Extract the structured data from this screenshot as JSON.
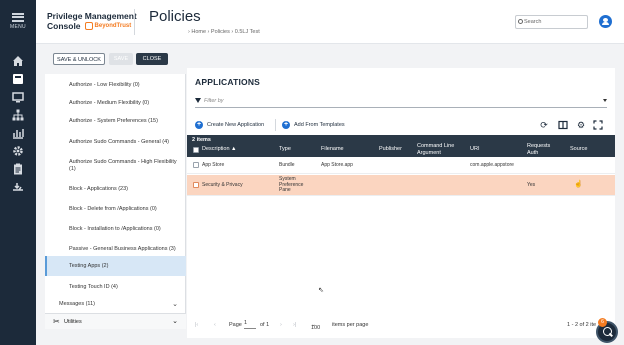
{
  "nav": {
    "menu_label": "MENU",
    "icons": [
      "home-icon",
      "policy-icon",
      "monitor-icon",
      "hierarchy-icon",
      "analytics-icon",
      "settings-icon",
      "clipboard-icon",
      "deploy-icon"
    ]
  },
  "header": {
    "brand_line1": "Privilege Management",
    "brand_line2": "Console",
    "brand_company": "BeyondTrust",
    "title": "Policies",
    "breadcrumb": "›  Home  ›  Policies  ›  0.5LJ Test",
    "search_placeholder": "Search"
  },
  "toolbar": {
    "save_unlock": "SAVE & UNLOCK",
    "save": "SAVE",
    "close": "CLOSE"
  },
  "sidebar": {
    "items": [
      {
        "label": "Authorize - Low Flexibility (0)"
      },
      {
        "label": "Authorize - Medium Flexibility (0)"
      },
      {
        "label": "Authorize - System Preferences (15)"
      },
      {
        "label": "Authorize Sudo Commands - General (4)"
      },
      {
        "label": "Authorize Sudo Commands - High Flexibility (1)"
      },
      {
        "label": "Block - Applications (23)"
      },
      {
        "label": "Block - Delete from /Applications (0)"
      },
      {
        "label": "Block - Installation to /Applications (0)"
      },
      {
        "label": "Passive - General Business Applications (3)"
      },
      {
        "label": "Testing Apps (2)"
      },
      {
        "label": "Testing Touch ID (4)"
      }
    ],
    "messages": "Messages (11)",
    "utilities": "Utilities"
  },
  "apps": {
    "title": "APPLICATIONS",
    "filter_placeholder": "Filter by",
    "create_label": "Create New Application",
    "templates_label": "Add From Templates",
    "count": "2 items",
    "columns": {
      "description": "Description ▲",
      "type": "Type",
      "filename": "Filename",
      "publisher": "Publisher",
      "cmd1": "Command Line",
      "cmd2": "Argument",
      "uri": "URI",
      "req1": "Requests",
      "req2": "Auth",
      "source": "Source"
    },
    "rows": [
      {
        "description": "App Store",
        "type": "Bundle",
        "filename": "App Store.app",
        "publisher": "",
        "uri": "com.apple.appstore",
        "requests": "",
        "source": ""
      },
      {
        "description": "Security & Privacy",
        "type1": "System",
        "type2": "Preference",
        "type3": "Pane",
        "filename": "",
        "publisher": "",
        "uri": "",
        "requests": "Yes",
        "source": ""
      }
    ]
  },
  "pager": {
    "page_label": "Page",
    "page_value": "1",
    "of_label": "of 1",
    "per_page_value": "100",
    "per_page_label": "items per page",
    "range": "1 - 2 of 2 ite",
    "help_badge": "6"
  }
}
